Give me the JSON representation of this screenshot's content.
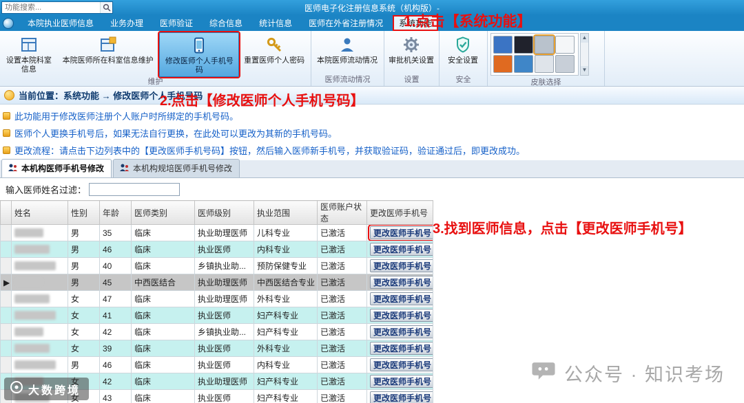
{
  "titlebar": {
    "search_placeholder": "功能搜索...",
    "title": "医师电子化注册信息系统（机构版）-"
  },
  "menu": {
    "items": [
      "本院执业医师信息",
      "业务办理",
      "医师验证",
      "综合信息",
      "统计信息",
      "医师在外省注册情况",
      "系统功能"
    ],
    "active": "系统功能"
  },
  "ribbon": {
    "buttons": [
      {
        "label": "设置本院科室信息",
        "icon": "department-grid-icon"
      },
      {
        "label": "本院医师所在科室信息维护",
        "icon": "department-maintain-icon"
      },
      {
        "label": "修改医师个人手机号码",
        "icon": "phone-icon",
        "active": true
      },
      {
        "label": "重置医师个人密码",
        "icon": "key-icon"
      },
      {
        "label": "本院医师流动情况",
        "icon": "doctor-person-icon"
      },
      {
        "label": "审批机关设置",
        "icon": "gear-icon"
      },
      {
        "label": "安全设置",
        "icon": "shield-icon"
      }
    ],
    "group_labels": [
      "维护",
      "医师流动情况",
      "设置",
      "安全",
      "皮肤选择"
    ],
    "skin_colors": [
      "#3b74c4",
      "#20222c",
      "#b9c2cc",
      "#f4f6f8",
      "#e06a20",
      "#3f86c8",
      "#dfe4ea",
      "#c8cfd8"
    ]
  },
  "breadcrumb": {
    "text": "当前位置：系统功能 → 修改医师个人手机号码"
  },
  "info_lines": [
    "此功能用于修改医师注册个人账户时所绑定的手机号码。",
    "医师个人更换手机号后，如果无法自行更换，在此处可以更改为其新的手机号码。",
    "更改流程：请点击下边列表中的【更改医师手机号码】按钮，然后输入医师新手机号，并获取验证码，验证通过后，即更改成功。"
  ],
  "tabs": [
    {
      "label": "本机构医师手机号修改",
      "active": true
    },
    {
      "label": "本机构规培医师手机号修改",
      "active": false
    }
  ],
  "filter": {
    "label": "输入医师姓名过滤：",
    "value": ""
  },
  "table": {
    "headers": [
      "姓名",
      "性别",
      "年龄",
      "医师类别",
      "医师级别",
      "执业范围",
      "医师账户状态",
      "更改医师手机号"
    ],
    "button_label": "更改医师手机号",
    "rows": [
      {
        "gender": "男",
        "age": "35",
        "category": "临床",
        "level": "执业助理医师",
        "scope": "儿科专业",
        "status": "已激活"
      },
      {
        "gender": "男",
        "age": "46",
        "category": "临床",
        "level": "执业医师",
        "scope": "内科专业",
        "status": "已激活"
      },
      {
        "gender": "男",
        "age": "40",
        "category": "临床",
        "level": "乡镇执业助...",
        "scope": "预防保健专业",
        "status": "已激活"
      },
      {
        "gender": "男",
        "age": "45",
        "category": "中西医结合",
        "level": "执业助理医师",
        "scope": "中西医结合专业",
        "status": "已激活",
        "selected": true
      },
      {
        "gender": "女",
        "age": "47",
        "category": "临床",
        "level": "执业助理医师",
        "scope": "外科专业",
        "status": "已激活"
      },
      {
        "gender": "女",
        "age": "41",
        "category": "临床",
        "level": "执业医师",
        "scope": "妇产科专业",
        "status": "已激活"
      },
      {
        "gender": "女",
        "age": "42",
        "category": "临床",
        "level": "乡镇执业助...",
        "scope": "妇产科专业",
        "status": "已激活"
      },
      {
        "gender": "女",
        "age": "39",
        "category": "临床",
        "level": "执业医师",
        "scope": "外科专业",
        "status": "已激活"
      },
      {
        "gender": "男",
        "age": "46",
        "category": "临床",
        "level": "执业医师",
        "scope": "内科专业",
        "status": "已激活"
      },
      {
        "gender": "女",
        "age": "42",
        "category": "临床",
        "level": "执业助理医师",
        "scope": "妇产科专业",
        "status": "已激活"
      },
      {
        "gender": "女",
        "age": "43",
        "category": "临床",
        "level": "执业医师",
        "scope": "妇产科专业",
        "status": "已激活"
      }
    ]
  },
  "annotations": {
    "step1": "1.点击【系统功能】",
    "step2": "2.点击【修改医师个人手机号码】",
    "step3": "3.找到医师信息，点击【更改医师手机号】"
  },
  "watermarks": {
    "bottom_left": "大数跨境",
    "bottom_right": "公众号 · 知识考场"
  },
  "colors": {
    "annotation_red": "#e81010",
    "titlebar_blue": "#2191d0",
    "row_stripe_cyan": "#c6f1ef",
    "active_button_blue": "#57aee6"
  }
}
